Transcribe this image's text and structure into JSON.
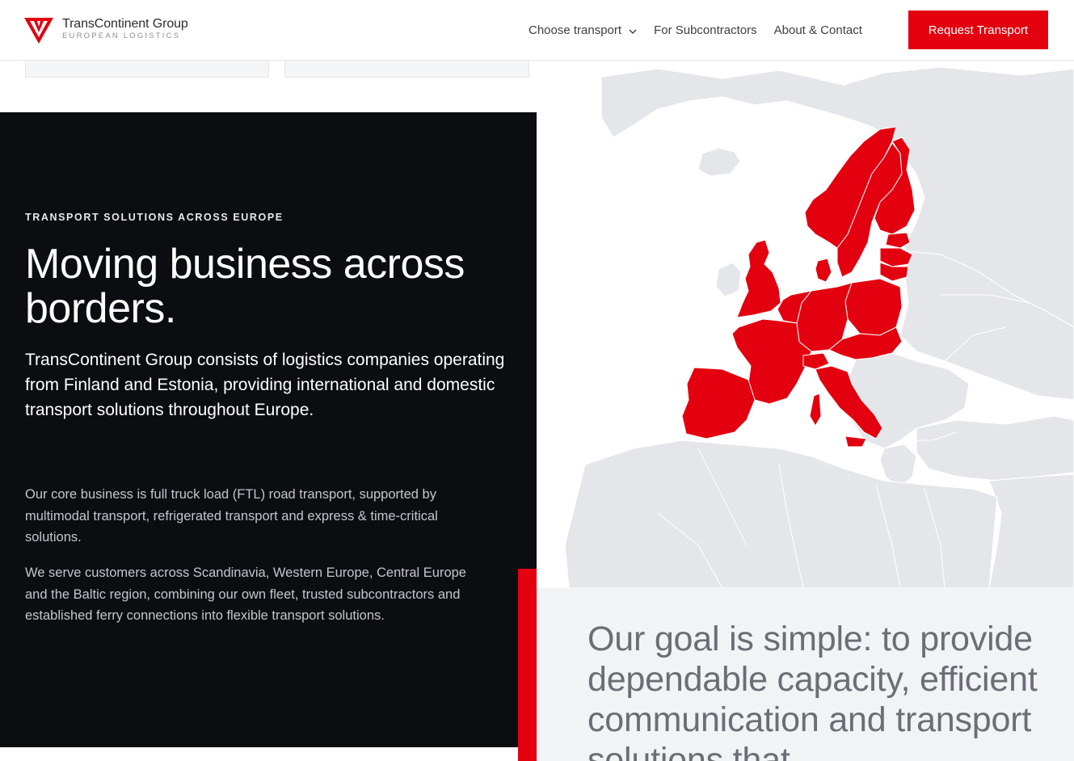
{
  "brand": {
    "name": "TransContinent Group",
    "tagline": "EUROPEAN LOGISTICS",
    "accent_color": "#e3000f",
    "dark_color": "#0b0d11"
  },
  "nav": {
    "items": [
      {
        "label": "Choose transport",
        "icon": "chevron-down-icon"
      },
      {
        "label": "For Subcontractors"
      },
      {
        "label": "About & Contact"
      }
    ],
    "cta_label": "Request Transport"
  },
  "hero": {
    "eyebrow": "TRANSPORT SOLUTIONS ACROSS EUROPE",
    "headline": "Moving business across borders.",
    "lead": "TransContinent Group consists of logistics companies operating from Finland and Estonia, providing international and domestic transport solutions throughout Europe.",
    "paragraphs": [
      "Our core business is full truck load (FTL) road transport, supported by multimodal transport, refrigerated transport and express & time-critical solutions.",
      "We serve customers across Scandinavia, Western Europe, Central Europe and the Baltic region, combining our own fleet, trusted subcontractors and established ferry connections into flexible transport solutions."
    ]
  },
  "map": {
    "icon": "europe-coverage-map",
    "highlight_color": "#e3000f",
    "land_color": "#e5e6e9"
  },
  "goal": {
    "text": "Our goal is simple: to provide dependable capacity, efficient communication and transport solutions that"
  }
}
